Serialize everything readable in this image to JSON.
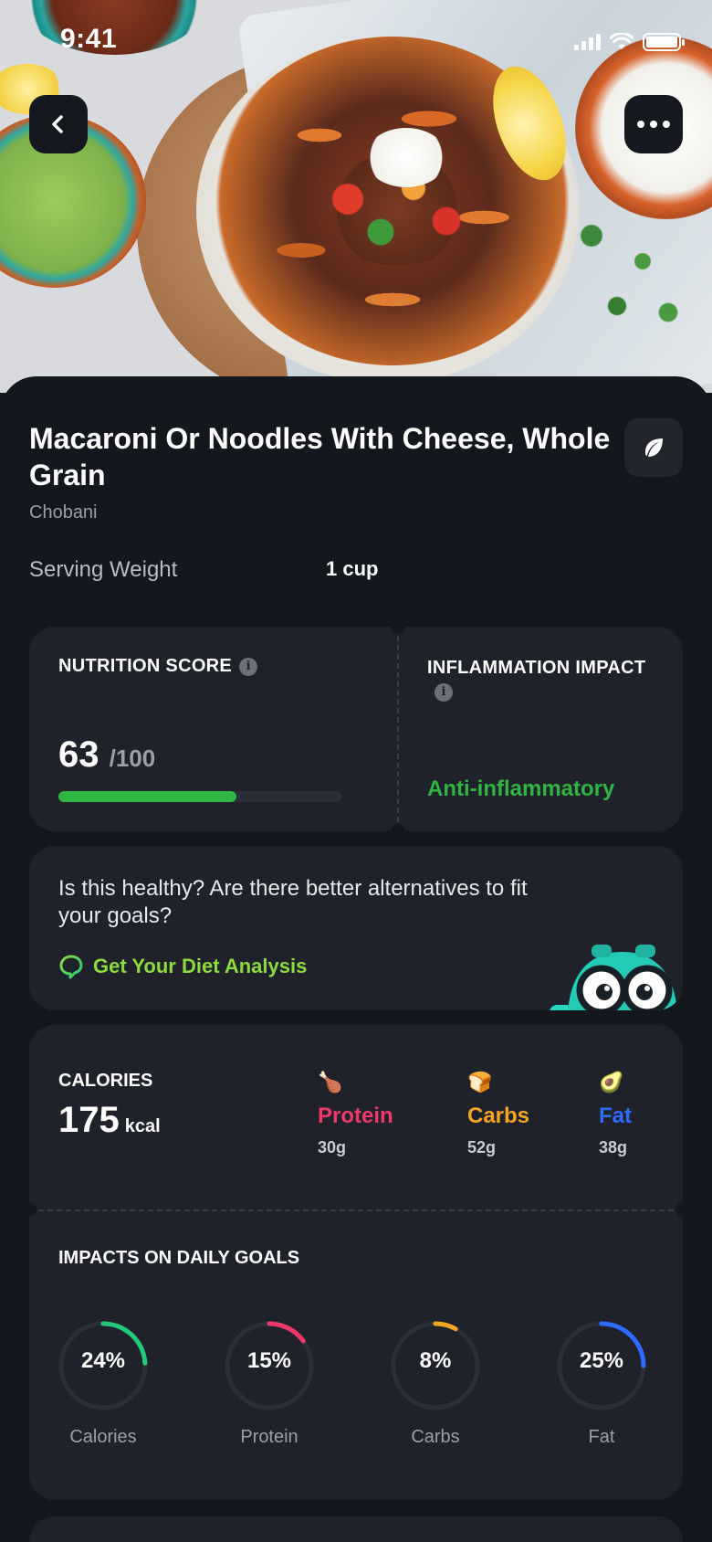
{
  "status_bar": {
    "time": "9:41"
  },
  "food": {
    "title": "Macaroni Or Noodles With Cheese, Whole Grain",
    "brand": "Chobani",
    "serving_label": "Serving Weight",
    "serving_value": "1 cup"
  },
  "nutrition_score": {
    "label": "NUTRITION SCORE",
    "score": "63",
    "max": "/100",
    "fraction": 0.63,
    "bar_color": "#2fb542"
  },
  "inflammation": {
    "label": "INFLAMMATION IMPACT",
    "value": "Anti-inflammatory",
    "color": "#2fb542"
  },
  "analysis": {
    "question": "Is this healthy? Are there better alternatives to fit your goals?",
    "cta": "Get Your Diet Analysis"
  },
  "calories": {
    "label": "CALORIES",
    "value": "175",
    "unit": "kcal",
    "macros": [
      {
        "icon": "drumstick-icon",
        "glyph": "🍗",
        "name": "Protein",
        "amount": "30g",
        "color": "#f0386b"
      },
      {
        "icon": "bread-icon",
        "glyph": "🍞",
        "name": "Carbs",
        "amount": "52g",
        "color": "#f5a524"
      },
      {
        "icon": "avocado-icon",
        "glyph": "🥑",
        "name": "Fat",
        "amount": "38g",
        "color": "#2f6bff"
      }
    ]
  },
  "daily_goals": {
    "title": "IMPACTS ON DAILY GOALS",
    "items": [
      {
        "label": "Calories",
        "pct_text": "24%",
        "fraction": 0.24,
        "color": "#22c97a"
      },
      {
        "label": "Protein",
        "pct_text": "15%",
        "fraction": 0.15,
        "color": "#f0386b"
      },
      {
        "label": "Carbs",
        "pct_text": "8%",
        "fraction": 0.08,
        "color": "#f5a524"
      },
      {
        "label": "Fat",
        "pct_text": "25%",
        "fraction": 0.25,
        "color": "#2f6bff"
      }
    ]
  },
  "icons": {
    "back": "chevron-left-icon",
    "more": "more-horizontal-icon",
    "leaf": "leaf-icon",
    "info": "info-icon",
    "chat": "chat-bubble-icon"
  }
}
